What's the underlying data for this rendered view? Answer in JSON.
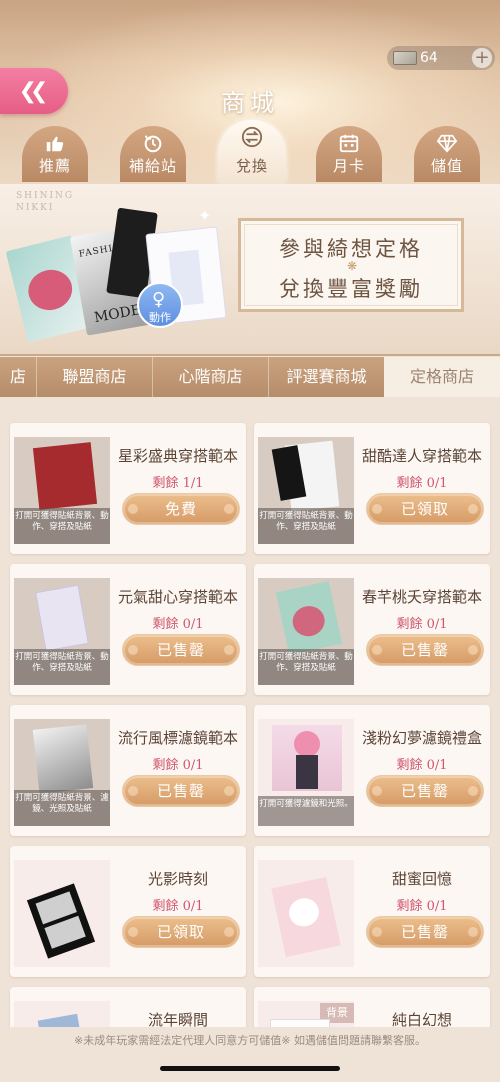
{
  "header": {
    "title": "商城",
    "currency_amount": "64",
    "tabs": [
      {
        "label": "推薦",
        "icon": "thumbs-up-icon",
        "active": false
      },
      {
        "label": "補給站",
        "icon": "clock-refresh-icon",
        "active": false
      },
      {
        "label": "兌換",
        "icon": "exchange-icon",
        "active": true
      },
      {
        "label": "月卡",
        "icon": "calendar-icon",
        "active": false
      },
      {
        "label": "儲值",
        "icon": "diamond-icon",
        "active": false
      }
    ]
  },
  "banner": {
    "brand_line1": "SHINING",
    "brand_line2": "NIKKI",
    "promo_line1": "參與綺想定格",
    "promo_line2": "兌換豐富獎勵",
    "card_text_top": "FASHION",
    "card_text_bottom": "MODE",
    "badge_label": "動作"
  },
  "shop_tabs": [
    "店",
    "聯盟商店",
    "心階商店",
    "評選賽商城",
    "定格商店"
  ],
  "shop_tab_active": "定格商店",
  "items": [
    {
      "name": "星彩盛典穿搭範本",
      "remaining": "剩餘 1/1",
      "button": "免費",
      "caption": "打開可獲得貼紙背景、動作、穿搭及貼紙"
    },
    {
      "name": "甜酷達人穿搭範本",
      "remaining": "剩餘 0/1",
      "button": "已領取",
      "caption": "打開可獲得貼紙背景、動作、穿搭及貼紙"
    },
    {
      "name": "元氣甜心穿搭範本",
      "remaining": "剩餘 0/1",
      "button": "已售罄",
      "caption": "打開可獲得貼紙背景、動作、穿搭及貼紙"
    },
    {
      "name": "春芊桃夭穿搭範本",
      "remaining": "剩餘 0/1",
      "button": "已售罄",
      "caption": "打開可獲得貼紙背景、動作、穿搭及貼紙"
    },
    {
      "name": "流行風標濾鏡範本",
      "remaining": "剩餘 0/1",
      "button": "已售罄",
      "caption": "打開可獲得貼紙背景、濾鏡、光照及貼紙"
    },
    {
      "name": "淺粉幻夢濾鏡禮盒",
      "remaining": "剩餘 0/1",
      "button": "已售罄",
      "caption": "打開可獲得濾鏡和光照。"
    },
    {
      "name": "光影時刻",
      "remaining": "剩餘 0/1",
      "button": "已領取",
      "caption": ""
    },
    {
      "name": "甜蜜回憶",
      "remaining": "剩餘 0/1",
      "button": "已售罄",
      "caption": ""
    },
    {
      "name": "流年瞬間",
      "remaining": "",
      "button": "",
      "caption": ""
    },
    {
      "name": "純白幻想",
      "remaining": "",
      "button": "",
      "caption": "",
      "tag": "背景"
    }
  ],
  "footer_note": "※未成年玩家需經法定代理人同意方可儲值※ 如遇儲值問題請聯繫客服。",
  "colors": {
    "accent_pink": "#e65d85",
    "tab_brown": "#b98965",
    "remaining_red": "#d0566e",
    "button_gold": "#d59a66"
  }
}
